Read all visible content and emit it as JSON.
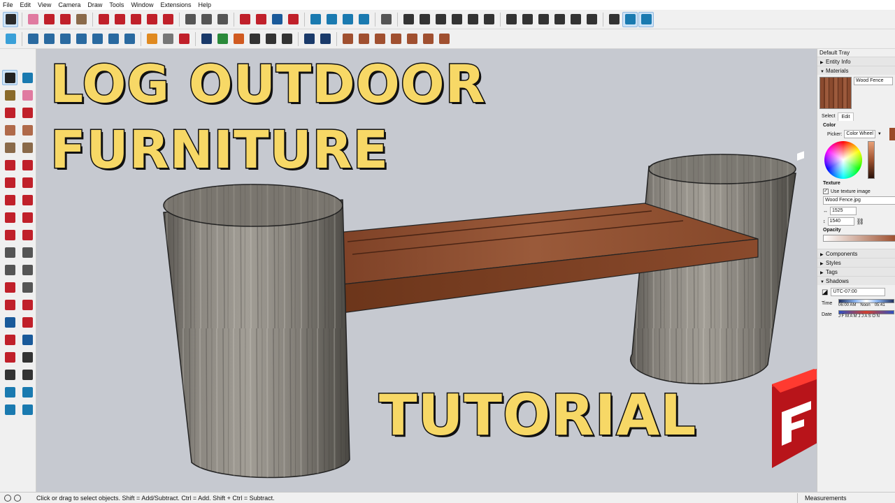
{
  "menu": [
    "File",
    "Edit",
    "View",
    "Camera",
    "Draw",
    "Tools",
    "Window",
    "Extensions",
    "Help"
  ],
  "toolbar_top": [
    {
      "icon": "select-arrow-icon",
      "color": "#2a2a2a",
      "active": true
    },
    {
      "icon": "eraser-icon",
      "color": "#e07aa0"
    },
    {
      "icon": "pencil-line-icon",
      "color": "#c0202a"
    },
    {
      "icon": "arc-icon",
      "color": "#c0202a"
    },
    {
      "icon": "shape-dropdown-icon",
      "color": "#8a6a4a"
    },
    {
      "icon": "push-pull-icon",
      "color": "#c0202a"
    },
    {
      "icon": "move-icon",
      "color": "#c0202a"
    },
    {
      "icon": "rotate-icon",
      "color": "#c0202a"
    },
    {
      "icon": "scale-icon",
      "color": "#c0202a"
    },
    {
      "icon": "offset-icon",
      "color": "#c0202a"
    },
    {
      "icon": "tape-measure-icon",
      "color": "#555"
    },
    {
      "icon": "text-icon",
      "color": "#555"
    },
    {
      "icon": "paint-bucket-icon",
      "color": "#555"
    },
    {
      "icon": "orbit-icon",
      "color": "#c0202a"
    },
    {
      "icon": "pan-icon",
      "color": "#c0202a"
    },
    {
      "icon": "zoom-icon",
      "color": "#1a5a9a"
    },
    {
      "icon": "zoom-extents-icon",
      "color": "#c0202a"
    },
    {
      "icon": "warehouse-icon",
      "color": "#1a7ab0"
    },
    {
      "icon": "extension-warehouse-icon",
      "color": "#1a7ab0"
    },
    {
      "icon": "layout-icon",
      "color": "#1a7ab0"
    },
    {
      "icon": "sandbox-icon",
      "color": "#1a7ab0"
    },
    {
      "icon": "account-icon",
      "color": "#555"
    },
    {
      "icon": "iso-view-icon",
      "color": "#333"
    },
    {
      "icon": "top-view-icon",
      "color": "#333"
    },
    {
      "icon": "front-view-icon",
      "color": "#333"
    },
    {
      "icon": "right-view-icon",
      "color": "#333"
    },
    {
      "icon": "back-view-icon",
      "color": "#333"
    },
    {
      "icon": "left-view-icon",
      "color": "#333"
    },
    {
      "icon": "xray-icon",
      "color": "#333"
    },
    {
      "icon": "wireframe-icon",
      "color": "#333"
    },
    {
      "icon": "hidden-line-icon",
      "color": "#333"
    },
    {
      "icon": "shaded-icon",
      "color": "#333"
    },
    {
      "icon": "shaded-texture-icon",
      "color": "#333"
    },
    {
      "icon": "monochrome-icon",
      "color": "#333"
    },
    {
      "icon": "axes-icon",
      "color": "#333"
    },
    {
      "icon": "section-plane-icon",
      "color": "#1a7ab0",
      "active": true
    },
    {
      "icon": "section-cut-icon",
      "color": "#1a7ab0",
      "active": true
    }
  ],
  "toolbar_second": [
    {
      "icon": "color-by-layer-icon",
      "color": "#3aa0d8"
    },
    {
      "icon": "axis-orient-icon",
      "color": "#2a6aa0"
    },
    {
      "icon": "axis-tool-icon",
      "color": "#2a6aa0"
    },
    {
      "icon": "dimension-icon",
      "color": "#2a6aa0"
    },
    {
      "icon": "protractor-icon",
      "color": "#2a6aa0"
    },
    {
      "icon": "walk-icon",
      "color": "#2a6aa0"
    },
    {
      "icon": "look-around-icon",
      "color": "#2a6aa0"
    },
    {
      "icon": "position-camera-icon",
      "color": "#2a6aa0"
    },
    {
      "icon": "solid-union-icon",
      "color": "#e08a20"
    },
    {
      "icon": "solid-refresh-icon",
      "color": "#777"
    },
    {
      "icon": "solid-trim-icon",
      "color": "#c0202a"
    },
    {
      "icon": "add-location-icon",
      "color": "#1a3a6a"
    },
    {
      "icon": "terrain-icon",
      "color": "#2a8a3a"
    },
    {
      "icon": "photo-texture-icon",
      "color": "#d05a20"
    },
    {
      "icon": "checker-icon",
      "color": "#333"
    },
    {
      "icon": "cloud-upload-icon",
      "color": "#333"
    },
    {
      "icon": "gear-icon",
      "color": "#333"
    },
    {
      "icon": "mail-icon",
      "color": "#1a3a6a"
    },
    {
      "icon": "info-icon",
      "color": "#1a3a6a"
    },
    {
      "icon": "sandbox-from-contours-icon",
      "color": "#a05030"
    },
    {
      "icon": "sandbox-from-scratch-icon",
      "color": "#a05030"
    },
    {
      "icon": "smoove-icon",
      "color": "#a05030"
    },
    {
      "icon": "stamp-icon",
      "color": "#a05030"
    },
    {
      "icon": "drape-icon",
      "color": "#a05030"
    },
    {
      "icon": "add-detail-icon",
      "color": "#a05030"
    },
    {
      "icon": "flip-edge-icon",
      "color": "#a05030"
    }
  ],
  "left_tools": [
    {
      "icon": "select-icon",
      "color": "#222",
      "active": true
    },
    {
      "icon": "make-component-icon",
      "color": "#1a7ab0"
    },
    {
      "icon": "paint-bucket-icon",
      "color": "#8a6a2a"
    },
    {
      "icon": "eraser-icon",
      "color": "#e07aa0"
    },
    {
      "icon": "line-icon",
      "color": "#c0202a"
    },
    {
      "icon": "freehand-icon",
      "color": "#c0202a"
    },
    {
      "icon": "rectangle-icon",
      "color": "#b06a4a"
    },
    {
      "icon": "rotated-rectangle-icon",
      "color": "#b06a4a"
    },
    {
      "icon": "circle-icon",
      "color": "#8a6a4a"
    },
    {
      "icon": "polygon-icon",
      "color": "#8a6a4a"
    },
    {
      "icon": "arc-icon",
      "color": "#c0202a"
    },
    {
      "icon": "two-point-arc-icon",
      "color": "#c0202a"
    },
    {
      "icon": "three-point-arc-icon",
      "color": "#c0202a"
    },
    {
      "icon": "pie-icon",
      "color": "#c0202a"
    },
    {
      "icon": "move-icon",
      "color": "#c0202a"
    },
    {
      "icon": "push-pull-icon",
      "color": "#c0202a"
    },
    {
      "icon": "rotate-icon",
      "color": "#c0202a"
    },
    {
      "icon": "follow-me-icon",
      "color": "#c0202a"
    },
    {
      "icon": "scale-icon",
      "color": "#c0202a"
    },
    {
      "icon": "offset-icon",
      "color": "#c0202a"
    },
    {
      "icon": "tape-measure-icon",
      "color": "#555"
    },
    {
      "icon": "dimension-icon",
      "color": "#555"
    },
    {
      "icon": "protractor-icon",
      "color": "#555"
    },
    {
      "icon": "text-icon",
      "color": "#555"
    },
    {
      "icon": "axes-icon",
      "color": "#c0202a"
    },
    {
      "icon": "3d-text-icon",
      "color": "#555"
    },
    {
      "icon": "orbit-icon",
      "color": "#c0202a"
    },
    {
      "icon": "pan-icon",
      "color": "#c0202a"
    },
    {
      "icon": "zoom-icon",
      "color": "#1a5a9a"
    },
    {
      "icon": "zoom-window-icon",
      "color": "#c0202a"
    },
    {
      "icon": "zoom-extents-icon",
      "color": "#c0202a"
    },
    {
      "icon": "previous-view-icon",
      "color": "#1a5a9a"
    },
    {
      "icon": "position-camera-icon",
      "color": "#c0202a"
    },
    {
      "icon": "look-around-icon",
      "color": "#333"
    },
    {
      "icon": "walk-icon",
      "color": "#333"
    },
    {
      "icon": "section-plane-icon",
      "color": "#333"
    },
    {
      "icon": "warehouse-icon",
      "color": "#1a7ab0"
    },
    {
      "icon": "extension-warehouse-icon",
      "color": "#1a7ab0"
    },
    {
      "icon": "layout-icon",
      "color": "#1a7ab0"
    },
    {
      "icon": "sandbox-icon",
      "color": "#1a7ab0"
    }
  ],
  "headline": {
    "line1": "LOG OUTDOOR",
    "line2": "FURNITURE",
    "line3": "TUTORIAL",
    "fill_color": "#f7d866",
    "outline_color": "#111111"
  },
  "tray": {
    "title": "Default Tray",
    "sections": {
      "entity_info": "Entity Info",
      "materials": "Materials",
      "components": "Components",
      "styles": "Styles",
      "tags": "Tags",
      "shadows": "Shadows"
    },
    "materials": {
      "name": "Wood Fence",
      "tab_select": "Select",
      "tab_edit": "Edit",
      "color_label": "Color",
      "picker_label": "Picker:",
      "picker_value": "Color Wheel",
      "texture_label": "Texture",
      "use_texture_label": "Use texture image",
      "use_texture_checked": true,
      "texture_file": "Wood Fence.jpg",
      "width": "1525",
      "height": "1540",
      "opacity_label": "Opacity"
    },
    "shadows": {
      "timezone": "UTC-07:00",
      "time_label": "Time",
      "time_ticks": [
        "06:00 AM",
        "Noon",
        "05:41"
      ],
      "date_label": "Date",
      "months": "J F M A M J J A S O N"
    }
  },
  "status": {
    "hint": "Click or drag to select objects. Shift = Add/Subtract. Ctrl = Add. Shift + Ctrl = Subtract.",
    "measurements_label": "Measurements"
  },
  "colors": {
    "viewport_bg": "#c6c9d0",
    "wood_bench": "#8a4a2e",
    "log_gray": "#8d8a84",
    "sketchup_red": "#e0201c"
  }
}
